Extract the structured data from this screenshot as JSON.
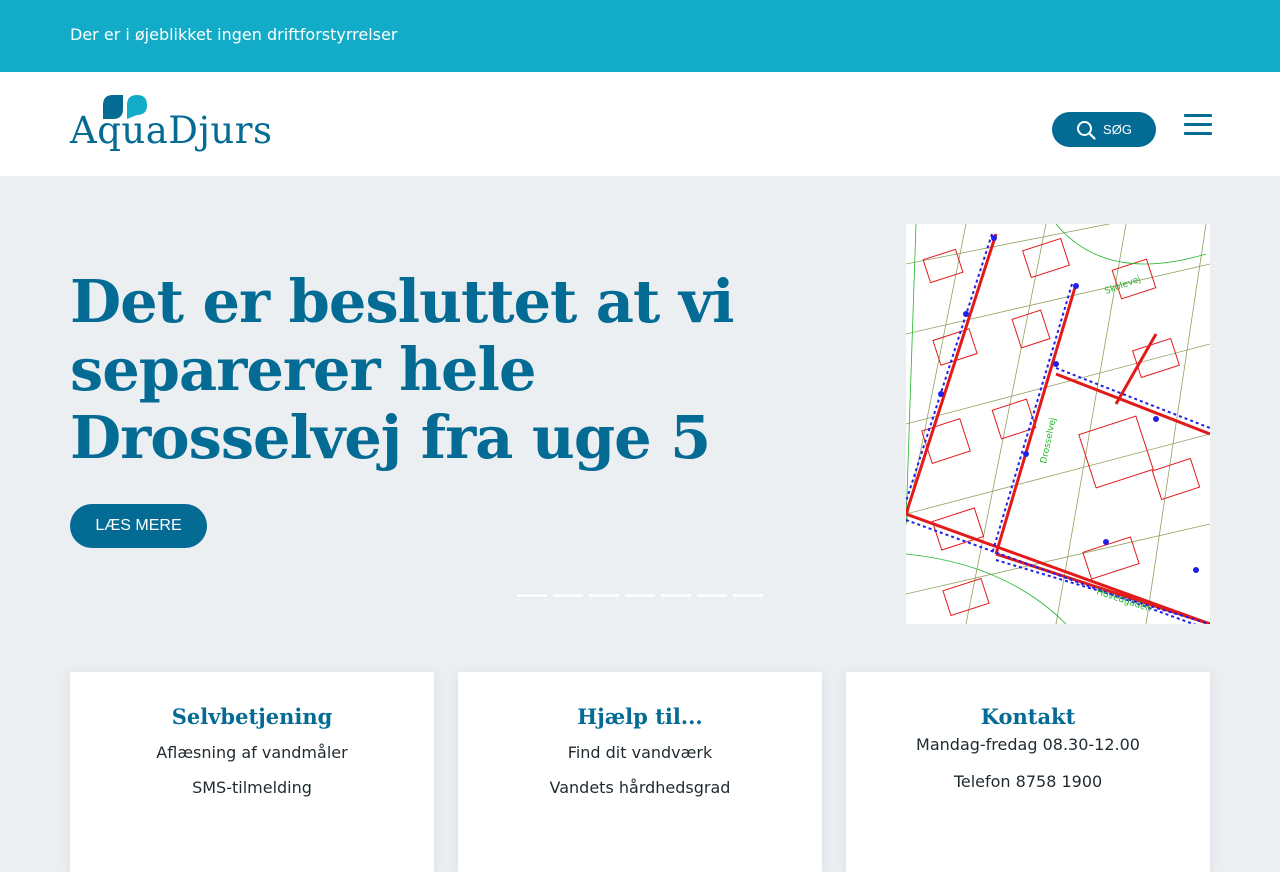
{
  "status_bar": {
    "text": "Der er i øjeblikket ingen driftforstyrrelser"
  },
  "header": {
    "logo_text": "AquaDjurs",
    "search_label": "SØG"
  },
  "hero": {
    "title": "Det er besluttet at vi separerer hele Drosselvej fra uge 5",
    "cta_label": "LÆS MERE",
    "slides_count": 7,
    "active_slide": 1
  },
  "cards": [
    {
      "title": "Selvbetjening",
      "items": [
        "Aflæsning af vandmåler",
        "SMS-tilmelding"
      ]
    },
    {
      "title": "Hjælp til...",
      "items": [
        "Find dit vandværk",
        "Vandets hårdhedsgrad"
      ]
    },
    {
      "title": "Kontakt",
      "items": [
        "Mandag-fredag 08.30-12.00",
        "Telefon 8758 1900"
      ]
    }
  ],
  "colors": {
    "topbar": "#12acc8",
    "primary": "#046b94",
    "page_bg": "#ebeff2"
  },
  "icons": {
    "search": "search-icon",
    "menu": "hamburger-menu-icon"
  }
}
